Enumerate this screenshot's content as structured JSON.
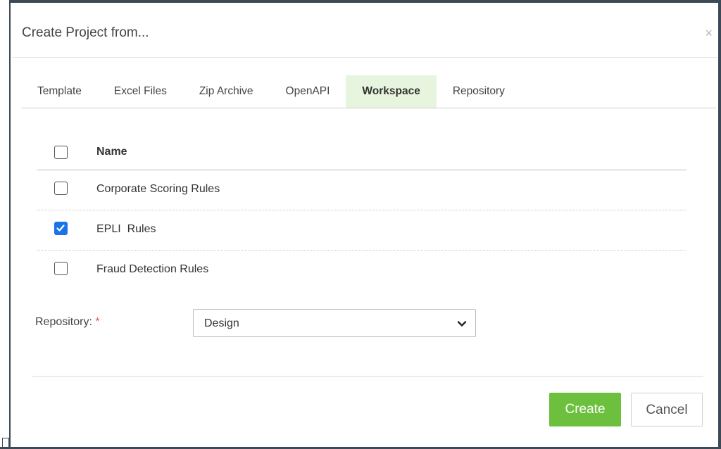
{
  "dialog": {
    "title": "Create Project from...",
    "close_symbol": "×"
  },
  "tabs": [
    {
      "label": "Template",
      "active": false
    },
    {
      "label": "Excel Files",
      "active": false
    },
    {
      "label": "Zip Archive",
      "active": false
    },
    {
      "label": "OpenAPI",
      "active": false
    },
    {
      "label": "Workspace",
      "active": true
    },
    {
      "label": "Repository",
      "active": false
    }
  ],
  "list": {
    "header": {
      "label": "Name",
      "checked": false
    },
    "rows": [
      {
        "label": "Corporate Scoring Rules",
        "checked": false
      },
      {
        "label": "EPLI  Rules",
        "checked": true
      },
      {
        "label": "Fraud Detection Rules",
        "checked": false
      }
    ]
  },
  "repository": {
    "label": "Repository:",
    "required_mark": "*",
    "selected": "Design"
  },
  "buttons": {
    "create": "Create",
    "cancel": "Cancel"
  },
  "colors": {
    "accent_green": "#6cc03e",
    "active_tab_bg": "#e8f5de",
    "checkbox_checked": "#1a73e8",
    "frame": "#3c4a57"
  },
  "icons": [
    "close-icon",
    "checkmark-icon",
    "chevron-down-icon"
  ]
}
